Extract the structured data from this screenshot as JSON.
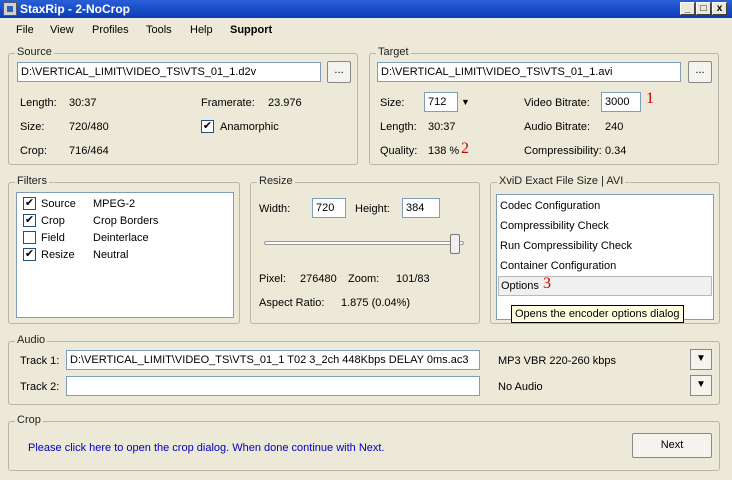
{
  "window": {
    "title": "StaxRip - 2-NoCrop",
    "minimize": "_",
    "maximize": "□",
    "close": "x"
  },
  "menu": [
    "File",
    "View",
    "Profiles",
    "Tools",
    "Help",
    "Support"
  ],
  "source": {
    "label": "Source",
    "path": "D:\\VERTICAL_LIMIT\\VIDEO_TS\\VTS_01_1.d2v",
    "browse": "...",
    "length_label": "Length:",
    "length": "30:37",
    "size_label": "Size:",
    "size": "720/480",
    "crop_label": "Crop:",
    "crop": "716/464",
    "framerate_label": "Framerate:",
    "framerate": "23.976",
    "anamorphic_label": "Anamorphic",
    "anamorphic_checked": "✔"
  },
  "target": {
    "label": "Target",
    "path": "D:\\VERTICAL_LIMIT\\VIDEO_TS\\VTS_01_1.avi",
    "browse": "...",
    "size_label": "Size:",
    "size": "712",
    "size_arrow": "▼",
    "length_label": "Length:",
    "length": "30:37",
    "quality_label": "Quality:",
    "quality": "138 %",
    "video_bitrate_label": "Video Bitrate:",
    "video_bitrate": "3000",
    "audio_bitrate_label": "Audio Bitrate:",
    "audio_bitrate": "240",
    "compressibility_label": "Compressibility:",
    "compressibility": "0.34",
    "marker1": "1",
    "marker2": "2"
  },
  "filters": {
    "label": "Filters",
    "items": [
      {
        "name": "Source",
        "value": "MPEG-2",
        "checked": "✔"
      },
      {
        "name": "Crop",
        "value": "Crop Borders",
        "checked": "✔"
      },
      {
        "name": "Field",
        "value": "Deinterlace",
        "checked": ""
      },
      {
        "name": "Resize",
        "value": "Neutral",
        "checked": "✔"
      }
    ]
  },
  "resize": {
    "label": "Resize",
    "width_label": "Width:",
    "width": "720",
    "height_label": "Height:",
    "height": "384",
    "slider_level": 0.98,
    "pixel_label": "Pixel:",
    "pixel": "276480",
    "zoom_label": "Zoom:",
    "zoom": "101/83",
    "aspect_label": "Aspect Ratio:",
    "aspect": "1.875 (0.04%)"
  },
  "encoder": {
    "label": "XviD Exact File Size | AVI",
    "items": [
      "Codec Configuration",
      "Compressibility Check",
      "Run Compressibility Check",
      "Container Configuration",
      "Options"
    ],
    "marker3": "3",
    "tooltip": "Opens the encoder options dialog"
  },
  "audio": {
    "label": "Audio",
    "track1_label": "Track 1:",
    "track1_path": "D:\\VERTICAL_LIMIT\\VIDEO_TS\\VTS_01_1 T02 3_2ch 448Kbps DELAY 0ms.ac3",
    "track1_profile": "MP3 VBR 220-260 kbps",
    "track2_label": "Track 2:",
    "track2_path": "",
    "track2_profile": "No Audio",
    "dropdown_arrow": "▼"
  },
  "crop": {
    "label": "Crop",
    "message": "Please click here to open the crop dialog. When done continue with Next.",
    "next": "Next"
  }
}
